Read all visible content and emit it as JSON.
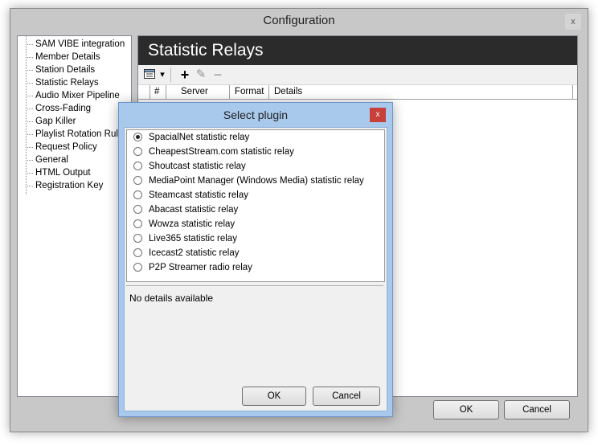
{
  "window": {
    "title": "Configuration",
    "close_glyph": "x",
    "ok_label": "OK",
    "cancel_label": "Cancel"
  },
  "tree": {
    "items": [
      {
        "label": "SAM VIBE integration"
      },
      {
        "label": "Member Details"
      },
      {
        "label": "Station Details"
      },
      {
        "label": "Statistic Relays"
      },
      {
        "label": "Audio Mixer Pipeline"
      },
      {
        "label": "Cross-Fading"
      },
      {
        "label": "Gap Killer"
      },
      {
        "label": "Playlist Rotation Rules"
      },
      {
        "label": "Request Policy"
      },
      {
        "label": "General"
      },
      {
        "label": "HTML Output"
      },
      {
        "label": "Registration Key"
      }
    ]
  },
  "content": {
    "title": "Statistic Relays",
    "toolbar": {
      "icons": [
        "relay-list-icon",
        "dropdown-arrow-icon",
        "add-icon",
        "edit-tools-icon",
        "remove-icon"
      ],
      "add_glyph": "+",
      "remove_glyph": "−",
      "dropdown_glyph": "▾",
      "edit_glyph": "✎"
    },
    "columns": [
      "#",
      "Server",
      "Format",
      "Details"
    ]
  },
  "modal": {
    "title": "Select plugin",
    "close_glyph": "x",
    "selected_index": 0,
    "options": [
      {
        "label": "SpacialNet statistic relay",
        "selected": true
      },
      {
        "label": "CheapestStream.com statistic relay",
        "selected": false
      },
      {
        "label": "Shoutcast statistic relay",
        "selected": false
      },
      {
        "label": "MediaPoint Manager (Windows Media) statistic relay",
        "selected": false
      },
      {
        "label": "Steamcast statistic relay",
        "selected": false
      },
      {
        "label": "Abacast statistic relay",
        "selected": false
      },
      {
        "label": "Wowza statistic relay",
        "selected": false
      },
      {
        "label": "Live365 statistic relay",
        "selected": false
      },
      {
        "label": "Icecast2 statistic relay",
        "selected": false
      },
      {
        "label": "P2P Streamer radio relay",
        "selected": false
      }
    ],
    "details_text": "No details available",
    "ok_label": "OK",
    "cancel_label": "Cancel"
  },
  "colors": {
    "title_bar_dark": "#2b2b2b",
    "modal_frame": "#a8c8ec",
    "close_red": "#c7403a"
  }
}
